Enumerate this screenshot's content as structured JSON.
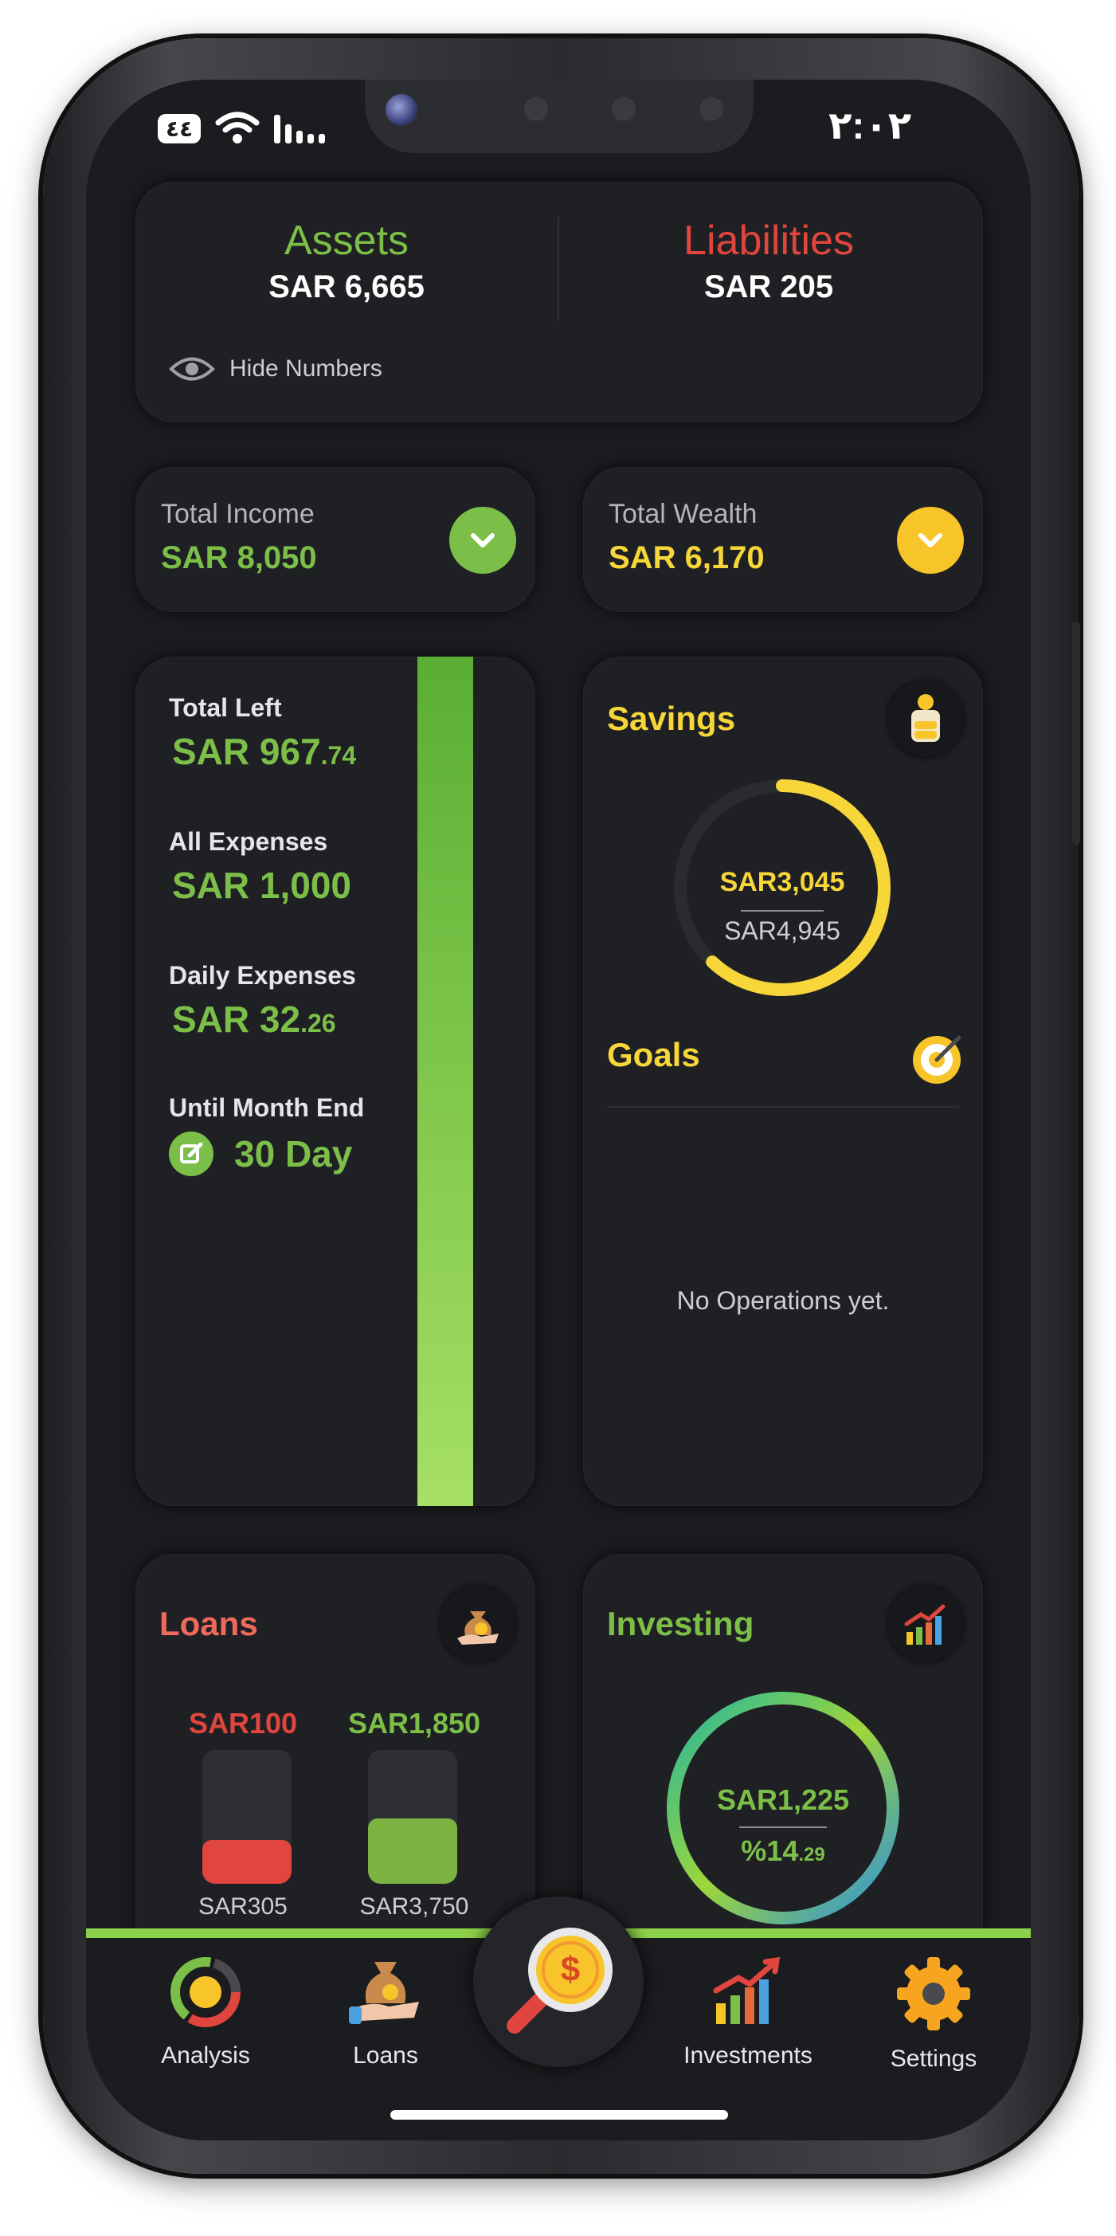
{
  "status": {
    "time": "٢:٠٢",
    "battery": "٤٤"
  },
  "summary": {
    "assets_label": "Assets",
    "assets_value": "SAR 6,665",
    "liabilities_label": "Liabilities",
    "liabilities_value": "SAR 205",
    "hide_numbers": "Hide Numbers"
  },
  "income": {
    "label": "Total Income",
    "value": "SAR 8,050"
  },
  "wealth": {
    "label": "Total Wealth",
    "value": "SAR 6,170"
  },
  "left_panel": {
    "total_left_label": "Total Left",
    "total_left_int": "SAR 967",
    "total_left_dec": ".74",
    "all_expenses_label": "All Expenses",
    "all_expenses_value": "SAR 1,000",
    "daily_expenses_label": "Daily Expenses",
    "daily_int": "SAR 32",
    "daily_dec": ".26",
    "month_end_label": "Until Month End",
    "month_end_value": "30 Day"
  },
  "savings": {
    "title": "Savings",
    "current": "SAR3,045",
    "target": "SAR4,945",
    "progress": 0.62
  },
  "goals": {
    "title": "Goals",
    "empty": "No Operations yet."
  },
  "loans": {
    "title": "Loans",
    "bars": [
      {
        "top": "SAR100",
        "bottom": "SAR305",
        "fill": 0.33,
        "color": "#e0453e"
      },
      {
        "top": "SAR1,850",
        "bottom": "SAR3,750",
        "fill": 0.49,
        "color": "#7cb342"
      }
    ]
  },
  "investing": {
    "title": "Investing",
    "value": "SAR1,225",
    "percent_int": "%14",
    "percent_dec": ".29"
  },
  "tabs": [
    {
      "label": "Analysis",
      "icon": "pie-chart-icon"
    },
    {
      "label": "Loans",
      "icon": "money-bag-hand-icon"
    },
    {
      "label": "Investments",
      "icon": "growth-chart-icon"
    },
    {
      "label": "Settings",
      "icon": "gear-icon"
    }
  ],
  "colors": {
    "green": "#7cbf48",
    "red": "#e0453e",
    "yellow": "#f7d63a",
    "card": "#1f2024"
  }
}
